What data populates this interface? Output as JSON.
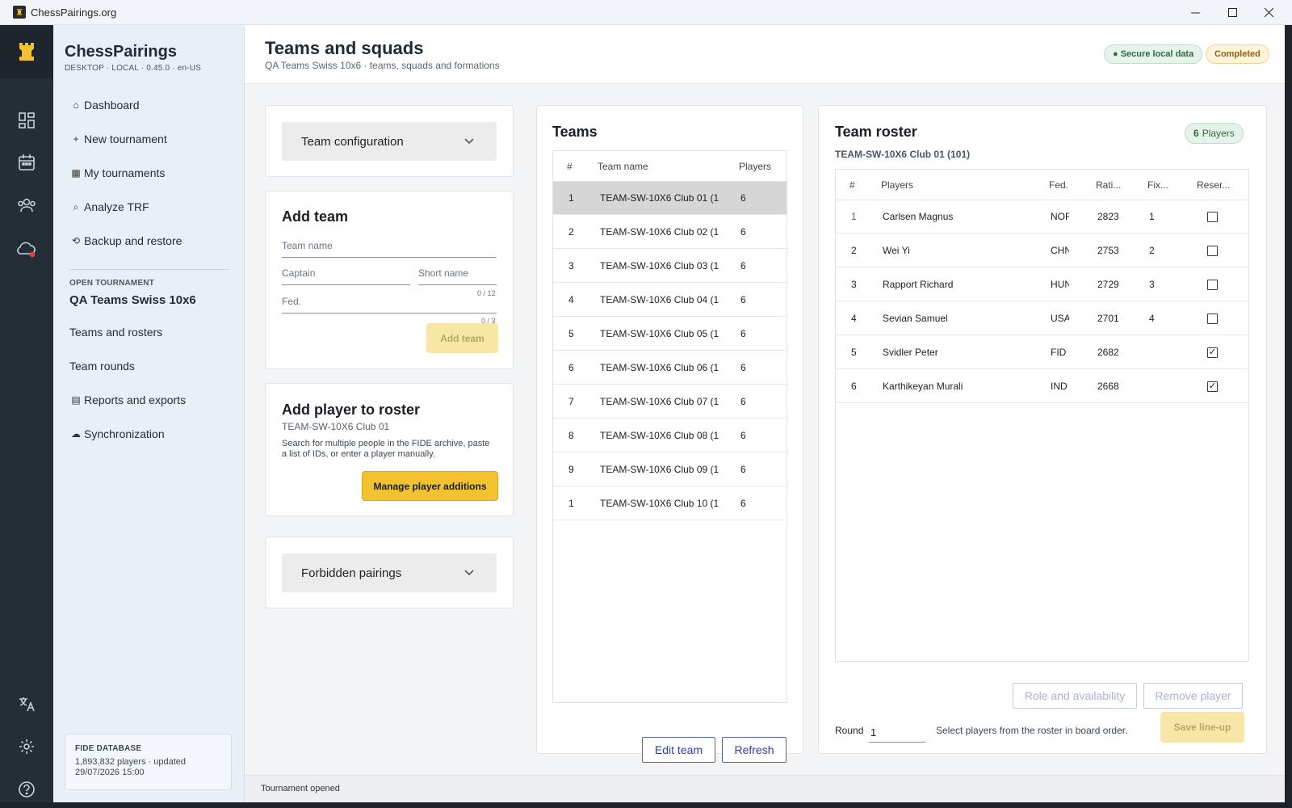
{
  "window": {
    "title": "ChessPairings.org",
    "minimize": "—",
    "maximize": "☐",
    "close": "✕"
  },
  "sidebar": {
    "brand": "ChessPairings",
    "brand_sub": "DESKTOP · LOCAL · 0.45.0 · en-US",
    "nav": [
      {
        "glyph": "⌂",
        "label": "Dashboard"
      },
      {
        "glyph": "+",
        "label": "New tournament"
      },
      {
        "glyph": "▦",
        "label": "My tournaments"
      },
      {
        "glyph": "⌕",
        "label": "Analyze TRF"
      },
      {
        "glyph": "⟲",
        "label": "Backup and restore"
      }
    ],
    "open_label": "OPEN TOURNAMENT",
    "open_name": "QA Teams Swiss 10x6",
    "tournament_nav": [
      {
        "glyph": "",
        "label": "Teams and rosters"
      },
      {
        "glyph": "",
        "label": "Team rounds"
      },
      {
        "glyph": "▤",
        "label": "Reports and exports"
      },
      {
        "glyph": "☁",
        "label": "Synchronization"
      }
    ],
    "fide": {
      "heading": "FIDE DATABASE",
      "line1": "1,893,832 players · updated",
      "line2": "29/07/2026 15:00"
    }
  },
  "header": {
    "title": "Teams and squads",
    "subtitle": "QA Teams Swiss 10x6 · teams, squads and formations",
    "badge_secure": "● Secure local data",
    "badge_status": "Completed"
  },
  "team_config": {
    "label": "Team configuration"
  },
  "add_team": {
    "title": "Add team",
    "team_name_placeholder": "Team name",
    "captain_placeholder": "Captain",
    "short_name_placeholder": "Short name",
    "short_counter": "0 / 12",
    "fed_placeholder": "Fed.",
    "fed_counter": "0 / 3",
    "button": "Add team"
  },
  "add_player": {
    "title": "Add player to roster",
    "team": "TEAM-SW-10X6 Club 01",
    "description": "Search for multiple people in the FIDE archive, paste a list of IDs, or enter a player manually.",
    "button": "Manage player additions"
  },
  "forbidden": {
    "label": "Forbidden pairings"
  },
  "teams": {
    "title": "Teams",
    "headers": {
      "num": "#",
      "name": "Team name",
      "players": "Players"
    },
    "rows": [
      {
        "num": "1",
        "name": "TEAM-SW-10X6 Club 01 (1",
        "players": "6"
      },
      {
        "num": "2",
        "name": "TEAM-SW-10X6 Club 02 (1",
        "players": "6"
      },
      {
        "num": "3",
        "name": "TEAM-SW-10X6 Club 03 (1",
        "players": "6"
      },
      {
        "num": "4",
        "name": "TEAM-SW-10X6 Club 04 (1",
        "players": "6"
      },
      {
        "num": "5",
        "name": "TEAM-SW-10X6 Club 05 (1",
        "players": "6"
      },
      {
        "num": "6",
        "name": "TEAM-SW-10X6 Club 06 (1",
        "players": "6"
      },
      {
        "num": "7",
        "name": "TEAM-SW-10X6 Club 07 (1",
        "players": "6"
      },
      {
        "num": "8",
        "name": "TEAM-SW-10X6 Club 08 (1",
        "players": "6"
      },
      {
        "num": "9",
        "name": "TEAM-SW-10X6 Club 09 (1",
        "players": "6"
      },
      {
        "num": "1",
        "name": "TEAM-SW-10X6 Club 10 (1",
        "players": "6"
      }
    ],
    "edit_button": "Edit team",
    "refresh_button": "Refresh"
  },
  "roster": {
    "title": "Team roster",
    "count": "6",
    "count_label": "Players",
    "team": "TEAM-SW-10X6 Club 01 (101)",
    "headers": {
      "num": "#",
      "players": "Players",
      "fed": "Fed.",
      "rating": "Rati...",
      "fix": "Fix...",
      "reserve": "Reser..."
    },
    "rows": [
      {
        "num": "1",
        "name": "Carlsen Magnus",
        "fed": "NOF",
        "rating": "2823",
        "fix": "1",
        "reserve": ""
      },
      {
        "num": "2",
        "name": "Wei Yi",
        "fed": "CHN",
        "rating": "2753",
        "fix": "2",
        "reserve": ""
      },
      {
        "num": "3",
        "name": "Rapport Richard",
        "fed": "HUN",
        "rating": "2729",
        "fix": "3",
        "reserve": ""
      },
      {
        "num": "4",
        "name": "Sevian Samuel",
        "fed": "USA",
        "rating": "2701",
        "fix": "4",
        "reserve": ""
      },
      {
        "num": "5",
        "name": "Svidler Peter",
        "fed": "FID",
        "rating": "2682",
        "fix": "",
        "reserve": "✓"
      },
      {
        "num": "6",
        "name": "Karthikeyan Murali",
        "fed": "IND",
        "rating": "2668",
        "fix": "",
        "reserve": "✓"
      }
    ],
    "role_button": "Role and availability",
    "remove_button": "Remove player",
    "round_label": "Round",
    "round_value": "1",
    "hint": "Select players from the roster in board order.",
    "save_button": "Save line-up"
  },
  "status_bar": "Tournament opened",
  "colors": {
    "accent": "#f2c230",
    "rail": "#252d36",
    "sidebar": "#e9eff7",
    "outline": "#5563b5"
  }
}
